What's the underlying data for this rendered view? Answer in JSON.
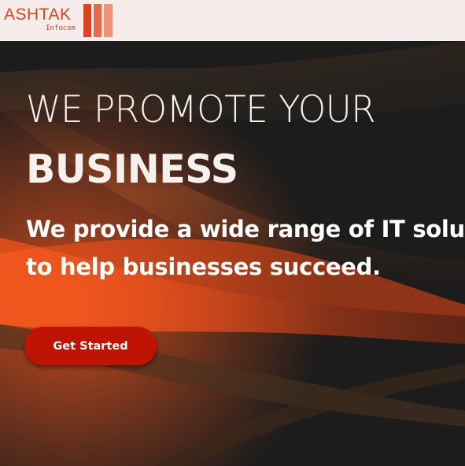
{
  "brand": {
    "name": "ASHTAK",
    "tagline": "Infocom",
    "color": "#e0441c"
  },
  "hero": {
    "headline_light": "WE PROMOTE YOUR",
    "headline_bold": "BUSINESS",
    "subheading_line1": "We provide a wide range of IT solut",
    "subheading_line2": "to help businesses succeed.",
    "cta_label": "Get Started"
  },
  "colors": {
    "header_bg": "#f6ecec",
    "hero_bg": "#1c1c1c",
    "accent": "#d9481a",
    "cta_bg": "#bf1404"
  }
}
